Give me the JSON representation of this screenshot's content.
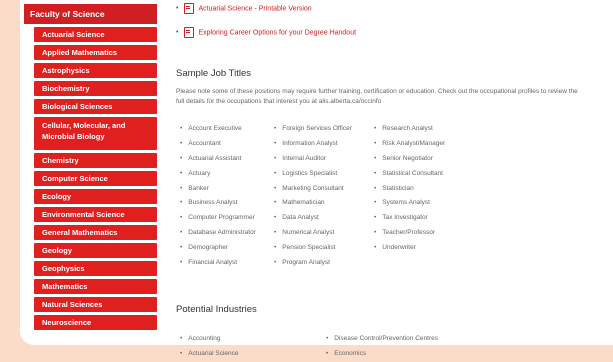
{
  "sidebar": {
    "header": "Faculty of Science",
    "items": [
      "Actuarial Science",
      "Applied Mathematics",
      "Astrophysics",
      "Biochemistry",
      "Biological Sciences",
      "Cellular, Molecular, and Microbial Biology",
      "Chemistry",
      "Computer Science",
      "Ecology",
      "Environmental Science",
      "General Mathematics",
      "Geology",
      "Geophysics",
      "Mathematics",
      "Natural Sciences",
      "Neuroscience"
    ]
  },
  "links": {
    "printable": "Actuarial Science - Printable Version",
    "career": "Exploring Career Options for your Degree Handout"
  },
  "jobs": {
    "title": "Sample Job Titles",
    "note": "Please note some of these positions may require further training, certification or education. Check out the occupational profiles to review the full details for the occupations that interest you at alis.alberta.ca/occinfo",
    "col1": [
      "Account Executive",
      "Accountant",
      "Actuarial Assistant",
      "Actuary",
      "Banker",
      "Business Analyst",
      "Computer Programmer",
      "Database Administrator",
      "Demographer",
      "Financial Analyst"
    ],
    "col2": [
      "Foreign Services Officer",
      "Information Analyst",
      "Internal Auditor",
      "Logistics Specialist",
      "Marketing Consultant",
      "Mathematician",
      "Data Analyst",
      "Numerical Analyst",
      "Pension Specialist",
      "Program Analyst"
    ],
    "col3": [
      "Research Analyst",
      "Risk Analyst/Manager",
      "Senior Negotiator",
      "Statistical Consultant",
      "Statistician",
      "Systems Analyst",
      "Tax Investigator",
      "Teacher/Professor",
      "Underwriter"
    ]
  },
  "industries": {
    "title": "Potential Industries",
    "col1": [
      "Accounting",
      "Actuarial Science"
    ],
    "col2": [
      "Disease Control/Prevention Centres",
      "Economics"
    ]
  },
  "colors": {
    "accent": "#e0201f",
    "background": "#fbdcc9"
  }
}
